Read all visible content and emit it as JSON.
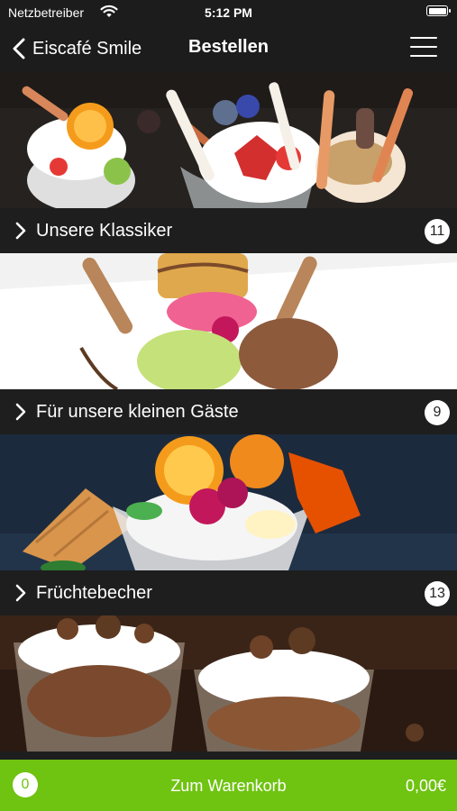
{
  "status_bar": {
    "carrier": "Netzbetreiber",
    "time": "5:12 PM"
  },
  "nav": {
    "back_label": "Eiscafé Smile",
    "title": "Bestellen"
  },
  "categories": [
    {
      "label": "Unsere Klassiker",
      "count": "11",
      "image": "ice-cream-sundaes-with-wafer-rolls"
    },
    {
      "label": "Für unsere kleinen Gäste",
      "count": "9",
      "image": "kids-ice-cream-cup-with-cone"
    },
    {
      "label": "Früchtebecher",
      "count": "13",
      "image": "fruit-sundae-with-orange-slices"
    },
    {
      "label": "",
      "count": "",
      "image": "nut-sundaes-with-whipped-cream"
    }
  ],
  "cart": {
    "count": "0",
    "label": "Zum Warenkorb",
    "total": "0,00€"
  },
  "colors": {
    "accent": "#6fc311",
    "background": "#1c1c1c"
  }
}
